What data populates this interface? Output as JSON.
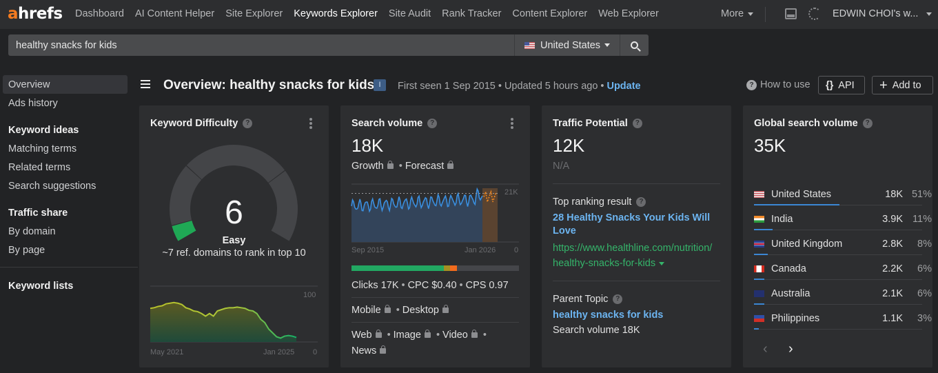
{
  "brand": {
    "logo_a": "a",
    "logo_rest": "hrefs",
    "accent": "#f47b20"
  },
  "nav": {
    "items": [
      {
        "label": "Dashboard",
        "active": false
      },
      {
        "label": "AI Content Helper",
        "active": false
      },
      {
        "label": "Site Explorer",
        "active": false
      },
      {
        "label": "Keywords Explorer",
        "active": true
      },
      {
        "label": "Site Audit",
        "active": false
      },
      {
        "label": "Rank Tracker",
        "active": false
      },
      {
        "label": "Content Explorer",
        "active": false
      },
      {
        "label": "Web Explorer",
        "active": false
      }
    ],
    "more_label": "More",
    "account_label": "EDWIN CHOI's w...",
    "inbox_icon": "inbox-icon",
    "gauge_icon": "credits-gauge-icon"
  },
  "search": {
    "query": "healthy snacks for kids",
    "country": "United States",
    "country_flag": "us-flag"
  },
  "sidebar": {
    "items": [
      {
        "label": "Overview",
        "heading": false,
        "active": true
      },
      {
        "label": "Ads history",
        "heading": false
      },
      {
        "label": "Keyword ideas",
        "heading": true
      },
      {
        "label": "Matching terms",
        "heading": false
      },
      {
        "label": "Related terms",
        "heading": false
      },
      {
        "label": "Search suggestions",
        "heading": false
      },
      {
        "label": "Traffic share",
        "heading": true
      },
      {
        "label": "By domain",
        "heading": false
      },
      {
        "label": "By page",
        "heading": false
      },
      {
        "label": "Keyword lists",
        "heading": true
      }
    ]
  },
  "header": {
    "title": "Overview: healthy snacks for kids",
    "intent_badge": "I",
    "first_seen": "First seen 1 Sep 2015",
    "updated": "Updated 5 hours ago",
    "update_link": "Update",
    "how_to_use": "How to use",
    "api_label": "API",
    "add_to_label": "Add to"
  },
  "kd": {
    "title": "Keyword Difficulty",
    "value": "6",
    "value_num": 6,
    "label": "Easy",
    "description": "~7 ref. domains to rank in top 10",
    "color": "#1fa855",
    "history": {
      "start": "May 2021",
      "end": "Jan 2025",
      "ymax": "100",
      "ymin": "0",
      "values": [
        52,
        53,
        55,
        56,
        59,
        60,
        61,
        60,
        58,
        53,
        51,
        48,
        47,
        44,
        40,
        44,
        40,
        48,
        50,
        52,
        53,
        53,
        54,
        53,
        52,
        49,
        48,
        44,
        35,
        30,
        20,
        14,
        8,
        6,
        9,
        10,
        9,
        7
      ]
    }
  },
  "sv": {
    "title": "Search volume",
    "value": "18K",
    "growth_label": "Growth",
    "forecast_label": "Forecast",
    "chart": {
      "start": "Sep 2015",
      "end": "Jan 2026",
      "ymax_label": "21K",
      "ymin_label": "0",
      "reference": 21000,
      "ymax": 25000
    },
    "click_share": {
      "organic": 0.55,
      "mixed": 0.04,
      "paid": 0.04
    },
    "clicks": "Clicks 17K",
    "cpc": "CPC $0.40",
    "cps": "CPS 0.97",
    "mobile": "Mobile",
    "desktop": "Desktop",
    "web": "Web",
    "image": "Image",
    "video": "Video",
    "news": "News"
  },
  "tp": {
    "title": "Traffic Potential",
    "value": "12K",
    "sub": "N/A",
    "top_label": "Top ranking result",
    "top_title": "28 Healthy Snacks Your Kids Will Love",
    "top_url_1": "https://www.healthline.com/nutrition/",
    "top_url_2": "healthy-snacks-for-kids",
    "parent_label": "Parent Topic",
    "parent_topic": "healthy snacks for kids",
    "parent_volume": "Search volume 18K"
  },
  "gsv": {
    "title": "Global search volume",
    "value": "35K",
    "countries": [
      {
        "name": "United States",
        "volume": "18K",
        "pct": "51%",
        "share": 0.51,
        "flag": "us"
      },
      {
        "name": "India",
        "volume": "3.9K",
        "pct": "11%",
        "share": 0.11,
        "flag": "in"
      },
      {
        "name": "United Kingdom",
        "volume": "2.8K",
        "pct": "8%",
        "share": 0.08,
        "flag": "gb"
      },
      {
        "name": "Canada",
        "volume": "2.2K",
        "pct": "6%",
        "share": 0.06,
        "flag": "ca"
      },
      {
        "name": "Australia",
        "volume": "2.1K",
        "pct": "6%",
        "share": 0.06,
        "flag": "au"
      },
      {
        "name": "Philippines",
        "volume": "1.1K",
        "pct": "3%",
        "share": 0.03,
        "flag": "ph"
      }
    ]
  }
}
